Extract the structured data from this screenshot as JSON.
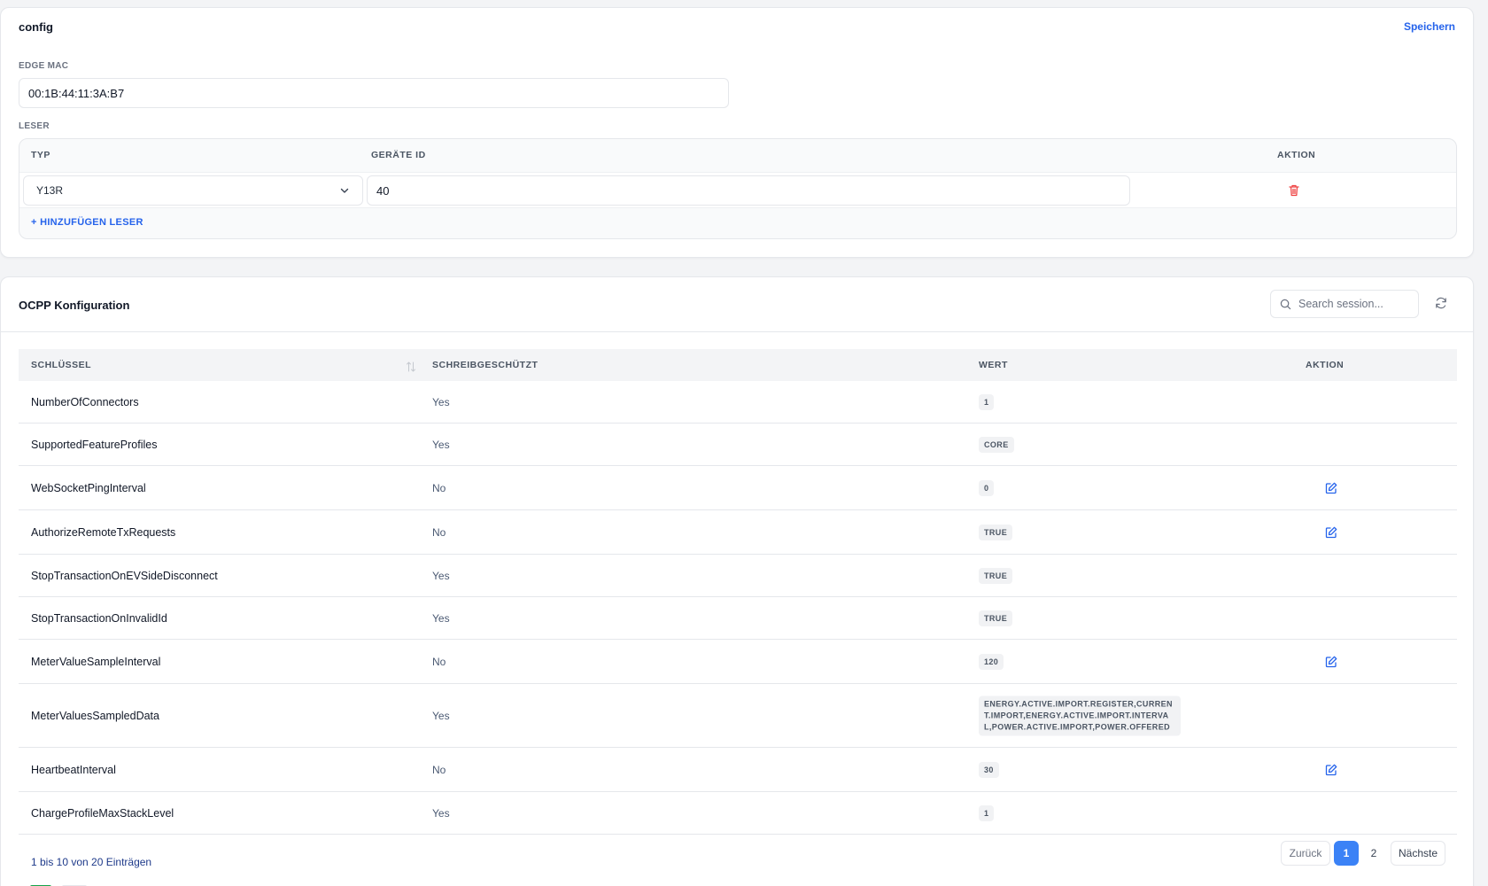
{
  "config": {
    "title": "config",
    "save_label": "Speichern",
    "edge_mac_label": "EDGE MAC",
    "edge_mac_value": "00:1B:44:11:3A:B7",
    "leser_label": "LESER",
    "leser_columns": {
      "typ": "TYP",
      "device_id": "GERÄTE ID",
      "action": "AKTION"
    },
    "readers": [
      {
        "typ": "Y13R",
        "device_id": "40"
      }
    ],
    "add_reader_label": "+ HINZUFÜGEN LESER"
  },
  "ocpp": {
    "title": "OCPP Konfiguration",
    "search_placeholder": "Search session...",
    "columns": {
      "key": "SCHLÜSSEL",
      "readonly": "SCHREIBGESCHÜTZT",
      "value": "WERT",
      "action": "AKTION"
    },
    "rows": [
      {
        "key": "NumberOfConnectors",
        "readonly": "Yes",
        "value": "1",
        "editable": false
      },
      {
        "key": "SupportedFeatureProfiles",
        "readonly": "Yes",
        "value": "CORE",
        "editable": false
      },
      {
        "key": "WebSocketPingInterval",
        "readonly": "No",
        "value": "0",
        "editable": true
      },
      {
        "key": "AuthorizeRemoteTxRequests",
        "readonly": "No",
        "value": "TRUE",
        "editable": true
      },
      {
        "key": "StopTransactionOnEVSideDisconnect",
        "readonly": "Yes",
        "value": "TRUE",
        "editable": false
      },
      {
        "key": "StopTransactionOnInvalidId",
        "readonly": "Yes",
        "value": "TRUE",
        "editable": false
      },
      {
        "key": "MeterValueSampleInterval",
        "readonly": "No",
        "value": "120",
        "editable": true
      },
      {
        "key": "MeterValuesSampledData",
        "readonly": "Yes",
        "value": "ENERGY.ACTIVE.IMPORT.REGISTER,CURRENT.IMPORT,ENERGY.ACTIVE.IMPORT.INTERVAL,POWER.ACTIVE.IMPORT,POWER.OFFERED",
        "editable": false
      },
      {
        "key": "HeartbeatInterval",
        "readonly": "No",
        "value": "30",
        "editable": true
      },
      {
        "key": "ChargeProfileMaxStackLevel",
        "readonly": "Yes",
        "value": "1",
        "editable": false
      }
    ],
    "pagination": {
      "info": "1 bis 10 von 20 Einträgen",
      "prev_label": "Zurück",
      "pages": [
        "1",
        "2"
      ],
      "current_page": "1",
      "next_label": "Nächste"
    }
  },
  "colors": {
    "accent": "#3b82f6",
    "link": "#2563eb",
    "danger": "#ef4444"
  },
  "icons": {
    "delete": "trash-icon",
    "edit": "edit-icon",
    "search": "search-icon",
    "refresh": "refresh-icon",
    "sort": "sort-icon",
    "select": "chevron-down-icon"
  }
}
